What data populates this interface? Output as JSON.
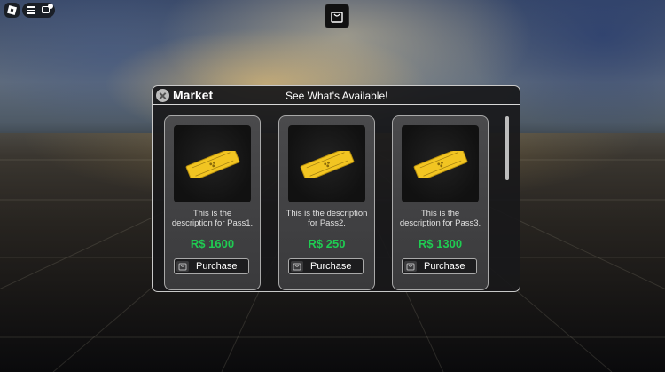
{
  "topbar": {
    "logo_icon": "roblox-logo-icon",
    "menu_icon": "hamburger-menu-icon",
    "chat_icon": "chat-icon",
    "shop_icon": "shopping-bag-icon"
  },
  "market": {
    "title": "Market",
    "subtitle": "See What's Available!",
    "close_icon": "close-icon",
    "passes": [
      {
        "description": "This is the\ndescription for Pass1.",
        "price": "R$ 1600",
        "button": "Purchase",
        "image_icon": "golden-ticket-icon"
      },
      {
        "description": "This is the description\nfor Pass2.",
        "price": "R$ 250",
        "button": "Purchase",
        "image_icon": "golden-ticket-icon"
      },
      {
        "description": "This is the\ndescription for Pass3.",
        "price": "R$ 1300",
        "button": "Purchase",
        "image_icon": "golden-ticket-icon"
      }
    ]
  },
  "colors": {
    "price_green": "#1fcc52",
    "ticket_gold": "#f2c522",
    "panel_border": "#c9c9c9"
  }
}
